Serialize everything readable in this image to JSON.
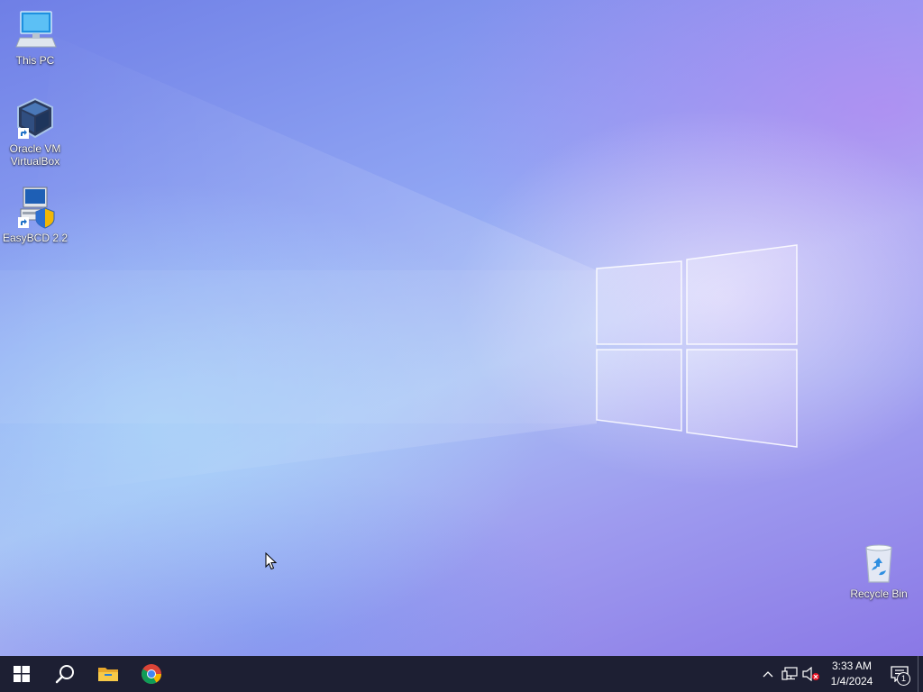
{
  "desktop": {
    "icons": [
      {
        "id": "this-pc",
        "label": "This PC",
        "icon": "computer-icon"
      },
      {
        "id": "virtualbox",
        "label": "Oracle VM\nVirtualBox",
        "label_line1": "Oracle VM",
        "label_line2": "VirtualBox",
        "icon": "virtualbox-cube-icon"
      },
      {
        "id": "easybcd",
        "label": "EasyBCD 2.2",
        "icon": "easybcd-icon"
      },
      {
        "id": "recycle-bin",
        "label": "Recycle Bin",
        "icon": "recycle-bin-icon"
      }
    ]
  },
  "taskbar": {
    "pinned": [
      {
        "name": "start-button",
        "icon": "windows-logo-icon"
      },
      {
        "name": "search-button",
        "icon": "search-icon"
      },
      {
        "name": "file-explorer-button",
        "icon": "folder-icon"
      },
      {
        "name": "chrome-button",
        "icon": "chrome-icon"
      }
    ],
    "tray": {
      "icons": [
        "chevron-up-icon",
        "network-icon",
        "volume-muted-icon"
      ],
      "time": "3:33 AM",
      "date": "1/4/2024",
      "notification_count": "1"
    }
  },
  "colors": {
    "taskbar": "#1d1f33",
    "accent": "#0078d7"
  }
}
